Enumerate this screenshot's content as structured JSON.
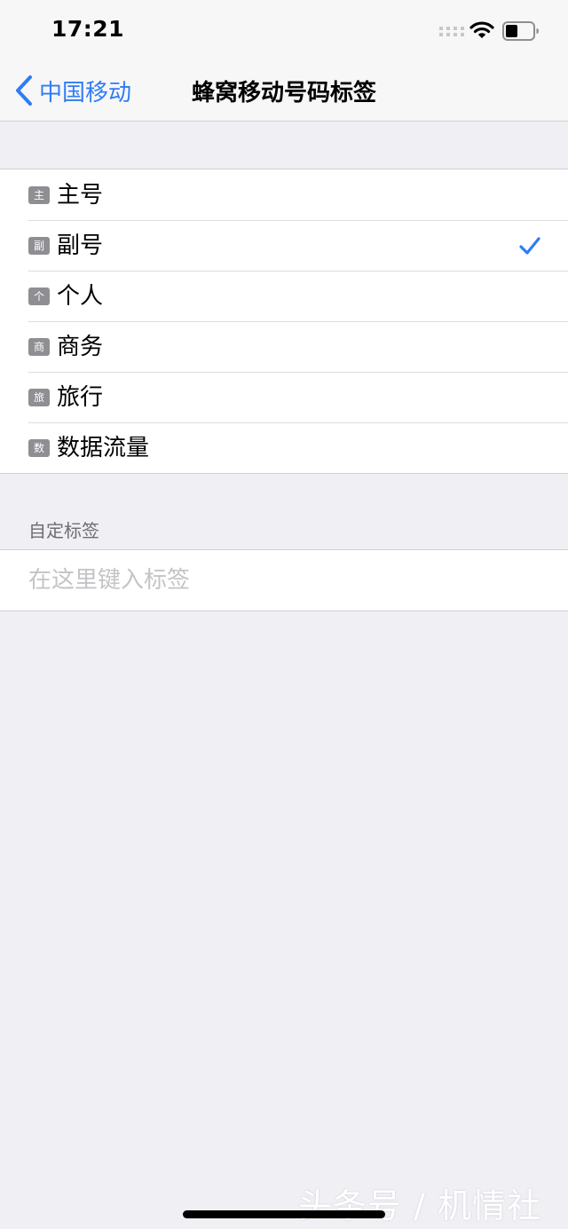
{
  "status_bar": {
    "time": "17:21",
    "icons": [
      "cellular-signal-icon",
      "wifi-icon",
      "battery-icon"
    ]
  },
  "nav": {
    "back_label": "中国移动",
    "title": "蜂窝移动号码标签"
  },
  "labels": {
    "items": [
      {
        "badge": "主",
        "label": "主号",
        "selected": false
      },
      {
        "badge": "副",
        "label": "副号",
        "selected": true
      },
      {
        "badge": "个",
        "label": "个人",
        "selected": false
      },
      {
        "badge": "商",
        "label": "商务",
        "selected": false
      },
      {
        "badge": "旅",
        "label": "旅行",
        "selected": false
      },
      {
        "badge": "数",
        "label": "数据流量",
        "selected": false
      }
    ]
  },
  "custom": {
    "header": "自定标签",
    "value": "",
    "placeholder": "在这里键入标签"
  },
  "watermark": "头条号 / 机情社",
  "colors": {
    "accent": "#2f7cf6",
    "background": "#efeff4",
    "badge": "#8e8e93",
    "placeholder": "#c4c4c8"
  }
}
